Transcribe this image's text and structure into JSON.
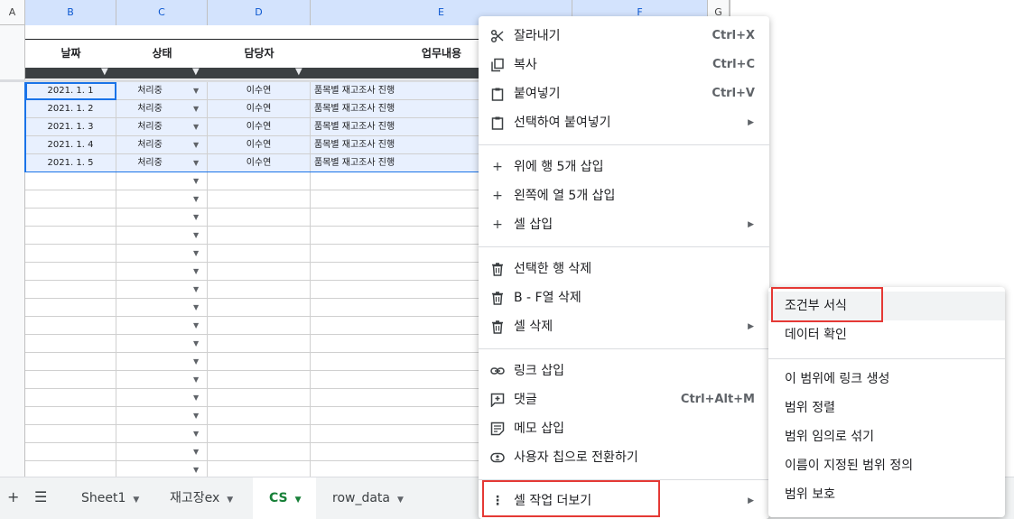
{
  "columns": [
    "A",
    "B",
    "C",
    "D",
    "E",
    "F",
    "G"
  ],
  "table": {
    "headers": [
      "날짜",
      "상태",
      "담당자",
      "업무내용"
    ],
    "rows": [
      {
        "date": "2021. 1. 1",
        "status": "처리중",
        "assignee": "이수연",
        "task": "품목별 재고조사 진행"
      },
      {
        "date": "2021. 1. 2",
        "status": "처리중",
        "assignee": "이수연",
        "task": "품목별 재고조사 진행"
      },
      {
        "date": "2021. 1. 3",
        "status": "처리중",
        "assignee": "이수연",
        "task": "품목별 재고조사 진행"
      },
      {
        "date": "2021. 1. 4",
        "status": "처리중",
        "assignee": "이수연",
        "task": "품목별 재고조사 진행"
      },
      {
        "date": "2021. 1. 5",
        "status": "처리중",
        "assignee": "이수연",
        "task": "품목별 재고조사 진행"
      }
    ]
  },
  "context_menu": {
    "cut": {
      "label": "잘라내기",
      "shortcut": "Ctrl+X"
    },
    "copy": {
      "label": "복사",
      "shortcut": "Ctrl+C"
    },
    "paste": {
      "label": "붙여넣기",
      "shortcut": "Ctrl+V"
    },
    "paste_special": {
      "label": "선택하여 붙여넣기"
    },
    "insert_rows": {
      "label": "위에 행 5개 삽입"
    },
    "insert_cols": {
      "label": "왼쪽에 열 5개 삽입"
    },
    "insert_cells": {
      "label": "셀 삽입"
    },
    "delete_rows": {
      "label": "선택한 행 삭제"
    },
    "delete_cols": {
      "label": "B - F열 삭제"
    },
    "delete_cells": {
      "label": "셀 삭제"
    },
    "insert_link": {
      "label": "링크 삽입"
    },
    "comment": {
      "label": "댓글",
      "shortcut": "Ctrl+Alt+M"
    },
    "insert_note": {
      "label": "메모 삽입"
    },
    "people_chip": {
      "label": "사용자 칩으로 전환하기"
    },
    "more_actions": {
      "label": "셀 작업 더보기"
    }
  },
  "submenu": {
    "conditional_format": "조건부 서식",
    "data_validation": "데이터 확인",
    "link_range": "이 범위에 링크 생성",
    "sort_range": "범위 정렬",
    "randomize_range": "범위 임의로 섞기",
    "named_range": "이름이 지정된 범위 정의",
    "protect_range": "범위 보호"
  },
  "sheet_tabs": [
    {
      "name": "Sheet1",
      "active": false
    },
    {
      "name": "재고장ex",
      "active": false
    },
    {
      "name": "CS",
      "active": true
    },
    {
      "name": "row_data",
      "active": false
    }
  ],
  "icons": {
    "add_sheet": "plus-icon",
    "all_sheets": "menu-icon",
    "cut": "scissors-icon",
    "copy": "copy-icon",
    "paste": "clipboard-icon",
    "insert": "plus-icon",
    "delete": "trash-icon",
    "link": "link-icon",
    "comment": "comment-plus-icon",
    "note": "note-icon",
    "people": "person-chip-icon",
    "more": "more-vertical-icon"
  },
  "colors": {
    "accent": "#1a73e8",
    "highlight_box": "#e53935",
    "active_tab": "#188038",
    "selection_fill": "#e8f0fe"
  }
}
